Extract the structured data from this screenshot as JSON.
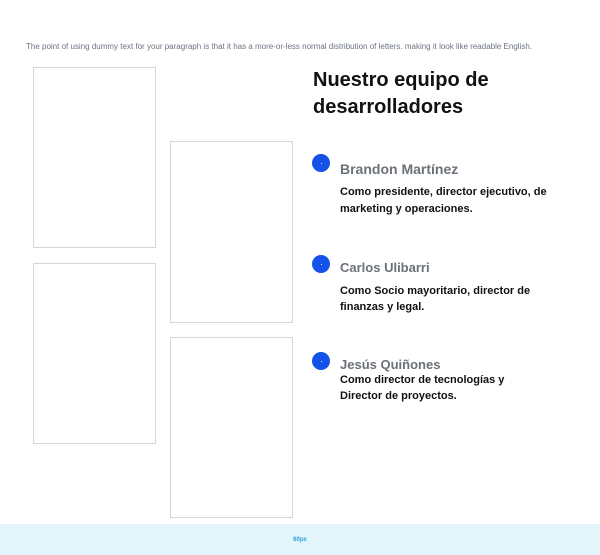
{
  "intro_text": "The point of using dummy text for your paragraph is that it has a more-or-less normal distribution of letters. making it look like readable English.",
  "team": {
    "title": "Nuestro equipo de desarrolladores",
    "members": [
      {
        "name": "Brandon Martínez",
        "role": "Como presidente, director ejecutivo, de marketing y operaciones."
      },
      {
        "name": "Carlos Ulibarri",
        "role": "Como Socio mayoritario, director de finanzas y legal."
      },
      {
        "name": "Jesús Quiñones",
        "role": "Como director de tecnologías y Director de proyectos."
      }
    ]
  },
  "footer": {
    "label": "60px"
  },
  "colors": {
    "accent_dot": "#1452e8",
    "footer_bg": "#e3f4fb",
    "footer_text": "#2aa6d6"
  }
}
